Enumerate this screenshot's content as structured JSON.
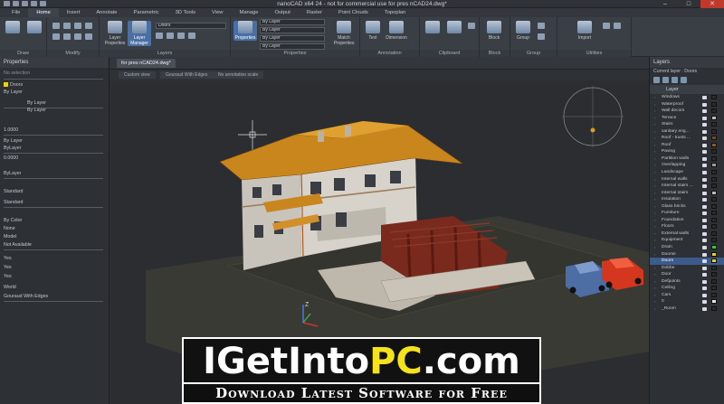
{
  "titlebar": {
    "title": "nanoCAD x64 24 - not for commercial use for pres nCAD24.dwg*",
    "min": "–",
    "max": "□",
    "close": "✕"
  },
  "ribbon_tabs": [
    "File",
    "Home",
    "Insert",
    "Annotate",
    "Parametric",
    "3D Tools",
    "View",
    "Manage",
    "Output",
    "Raster",
    "Point Clouds",
    "Topoplan"
  ],
  "ribbon": {
    "groups": [
      "Draw",
      "Modify",
      "Layers",
      "Properties",
      "Annotation",
      "Clipboard",
      "Block",
      "Group",
      "Utilities"
    ],
    "layer_properties": "Layer Properties",
    "layer_manager": "Layer Manager",
    "properties": "Properties",
    "match_properties": "Match Properties",
    "text": "Text",
    "dimension": "Dimension",
    "block": "Block",
    "group": "Group",
    "import": "Import",
    "layer_combo": "Doors",
    "color_combo": "By Layer",
    "linetype_combo": "By Layer",
    "lineweight_combo": "By Layer",
    "plot_combo": "By Layer"
  },
  "left_panel": {
    "title": "Properties",
    "selection": "No selection",
    "rows": [
      "Doors",
      "By Layer",
      "By Layer",
      "By Layer",
      "1.0000",
      "By Layer",
      "ByLayer",
      "0.0000",
      "ByLayer",
      "Standard",
      "Standard",
      "By Color",
      "None",
      "Model",
      "Not Available",
      "Yes",
      "Yes",
      "Yes",
      "World",
      "Gouraud With Edges"
    ]
  },
  "doc_tabs": [
    "for pres nCAD24.dwg*"
  ],
  "view_tabs": [
    "Custom view",
    "Gouraud With Edges",
    "No annotation scale"
  ],
  "viewport": {
    "axis_label": "Z"
  },
  "right_panel": {
    "title": "Layers",
    "current": "Current layer : Doors",
    "column": "Layer",
    "layers": [
      {
        "name": "Windows",
        "color": "#2a2a2a"
      },
      {
        "name": "Waterproof",
        "color": "#2a2a2a"
      },
      {
        "name": "Wall decors",
        "color": "#2a2a2a"
      },
      {
        "name": "Terrace",
        "color": "#b8b8b8"
      },
      {
        "name": "Stairs",
        "color": "#2a2a2a"
      },
      {
        "name": "sanitary eng...",
        "color": "#2a2a2a"
      },
      {
        "name": "Roof - trusts ...",
        "color": "#7a4a1a"
      },
      {
        "name": "Roof",
        "color": "#8a5a20"
      },
      {
        "name": "Paving",
        "color": "#2a2a2a"
      },
      {
        "name": "Partition walls",
        "color": "#2a2a2a"
      },
      {
        "name": "Overlapping",
        "color": "#9a9a9a"
      },
      {
        "name": "Landscape",
        "color": "#2a2a2a"
      },
      {
        "name": "Internal walls",
        "color": "#2a2a2a"
      },
      {
        "name": "Internal stairs ...",
        "color": "#2a2a2a"
      },
      {
        "name": "Internal stairs",
        "color": "#b8b8b8"
      },
      {
        "name": "Insulation",
        "color": "#2a2a2a"
      },
      {
        "name": "Glass bricks",
        "color": "#2a2a2a"
      },
      {
        "name": "Furniture",
        "color": "#2a2a2a"
      },
      {
        "name": "Foundation",
        "color": "#2a2a2a"
      },
      {
        "name": "Floors",
        "color": "#2a2a2a"
      },
      {
        "name": "External walls",
        "color": "#2a2a2a"
      },
      {
        "name": "Equipment",
        "color": "#2a2a2a"
      },
      {
        "name": "Drain",
        "color": "#2bd12b"
      },
      {
        "name": "Doorse",
        "color": "#e8d21a"
      },
      {
        "name": "Doors",
        "color": "#e8d21a"
      },
      {
        "name": "Dobbe",
        "color": "#2a2a2a"
      },
      {
        "name": "Door",
        "color": "#2a2a2a"
      },
      {
        "name": "Defpoints",
        "color": "#2a2a2a"
      },
      {
        "name": "Ceiling",
        "color": "#2a2a2a"
      },
      {
        "name": "Cars",
        "color": "#2a2a2a"
      },
      {
        "name": "0",
        "color": "#e6e6e6"
      },
      {
        "name": "_Room",
        "color": "#2a2a2a"
      }
    ],
    "selected_index": 24
  },
  "watermark": {
    "part1": "IGetInto",
    "part2": "PC",
    "part3": ".com",
    "tagline": "Download Latest Software for Free"
  }
}
